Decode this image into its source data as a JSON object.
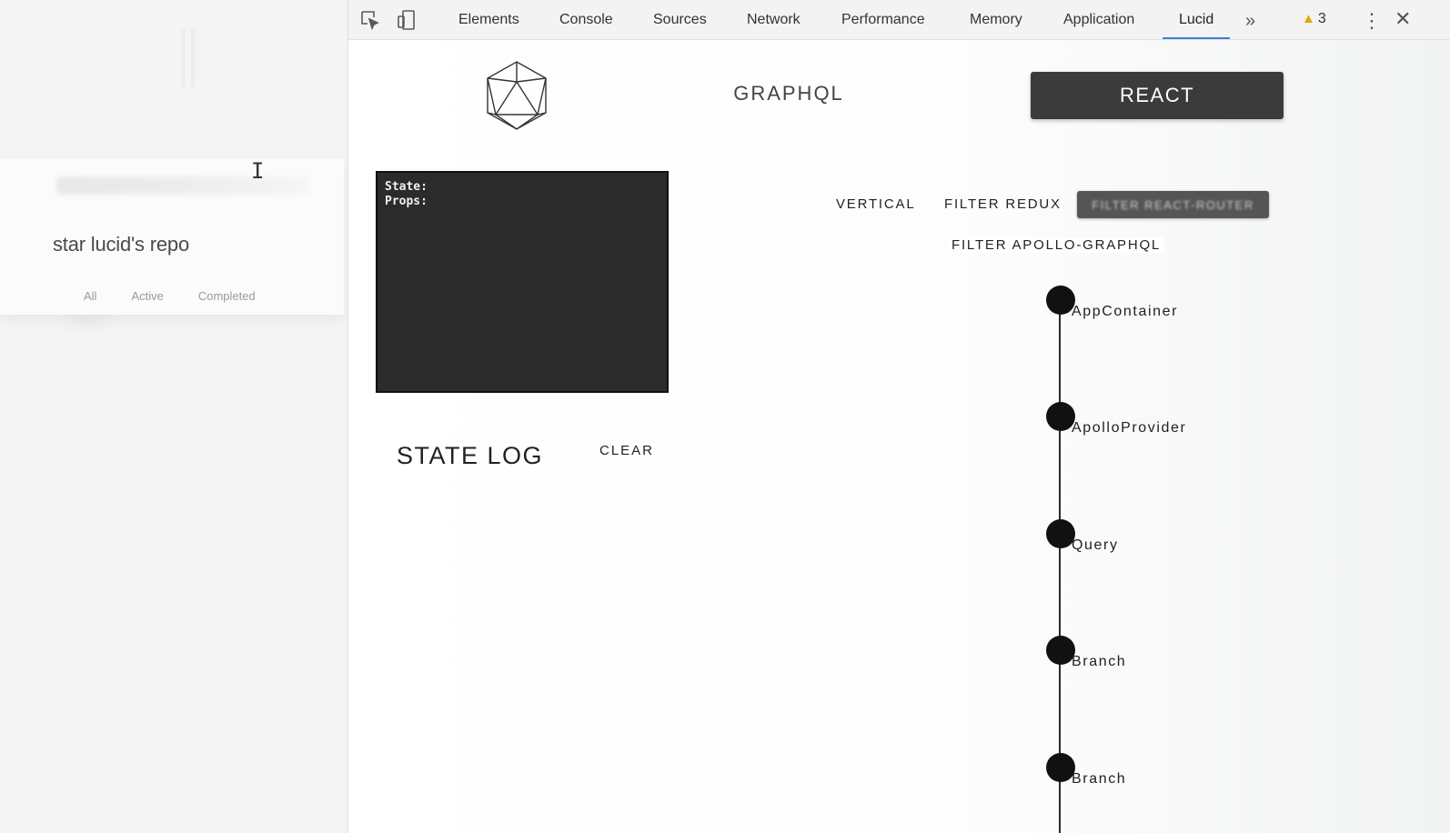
{
  "app": {
    "title": "star lucid's repo",
    "filters": [
      "All",
      "Active",
      "Completed"
    ]
  },
  "devtools": {
    "tabs": [
      "Elements",
      "Console",
      "Sources",
      "Network",
      "Performance",
      "Memory",
      "Application",
      "Lucid"
    ],
    "active_tab": "Lucid",
    "more_label": "»",
    "warning_count": "3",
    "kebab": "⋮",
    "close": "✕"
  },
  "lucid": {
    "graphql_label": "GRAPHQL",
    "react_label": "REACT",
    "state_box": {
      "state_label": "State:",
      "props_label": "Props:"
    },
    "state_log_title": "STATE LOG",
    "clear_label": "CLEAR",
    "options": {
      "vertical": "VERTICAL",
      "filter_redux": "FILTER REDUX",
      "filter_react_router": "FILTER REACT-ROUTER",
      "filter_apollo": "FILTER APOLLO-GRAPHQL"
    },
    "tree_nodes": [
      "AppContainer",
      "ApolloProvider",
      "Query",
      "Branch",
      "Branch"
    ]
  },
  "icons": {
    "inspect": "inspect-element-icon",
    "device": "device-toolbar-icon",
    "warning": "warning-icon",
    "logo": "icosahedron-logo-icon"
  },
  "colors": {
    "react_button": "#3b3b3b",
    "active_tab_underline": "#3f7ce0",
    "warning": "#e0a800",
    "state_box_bg": "#2b2b2b"
  }
}
